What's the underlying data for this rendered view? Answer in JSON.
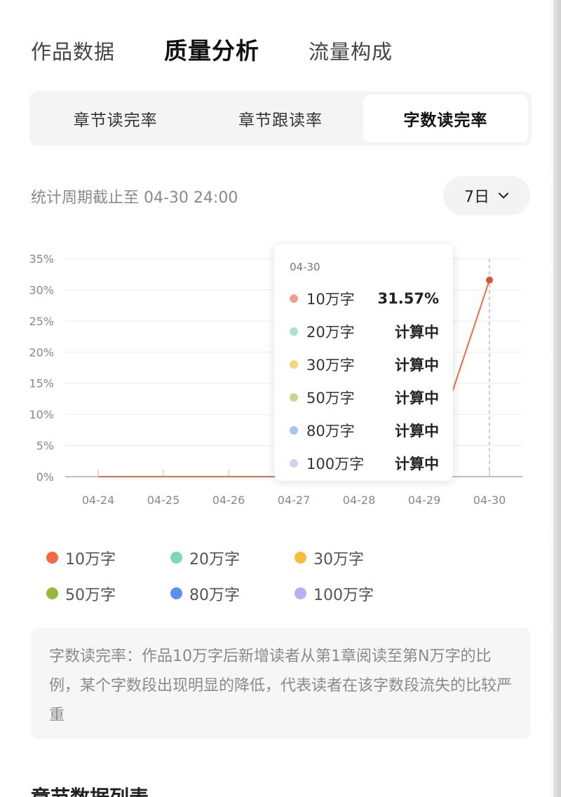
{
  "tabs": [
    {
      "label": "作品数据",
      "active": false
    },
    {
      "label": "质量分析",
      "active": true
    },
    {
      "label": "流量构成",
      "active": false
    }
  ],
  "segments": [
    {
      "label": "章节读完率",
      "active": false
    },
    {
      "label": "章节跟读率",
      "active": false
    },
    {
      "label": "字数读完率",
      "active": true
    }
  ],
  "period": {
    "text": "统计周期截止至 04-30 24:00"
  },
  "range_selector": {
    "value": "7日",
    "icon": "chevron-down-icon"
  },
  "chart_data": {
    "type": "line",
    "categories": [
      "04-24",
      "04-25",
      "04-26",
      "04-27",
      "04-28",
      "04-29",
      "04-30"
    ],
    "y_ticks": [
      "35%",
      "30%",
      "25%",
      "20%",
      "15%",
      "10%",
      "5%",
      "0%"
    ],
    "ylim": [
      0,
      35
    ],
    "grid": true,
    "series": [
      {
        "name": "10万字",
        "color": "#f26b45",
        "values": [
          0,
          0,
          0,
          0,
          0,
          0,
          31.57
        ]
      }
    ]
  },
  "tooltip": {
    "date": "04-30",
    "rows": [
      {
        "name": "10万字",
        "value": "31.57%",
        "color": "#f0a088"
      },
      {
        "name": "20万字",
        "value": "计算中",
        "color": "#a9e3cc"
      },
      {
        "name": "30万字",
        "value": "计算中",
        "color": "#f5d480"
      },
      {
        "name": "50万字",
        "value": "计算中",
        "color": "#c4d98e"
      },
      {
        "name": "80万字",
        "value": "计算中",
        "color": "#a9c3f0"
      },
      {
        "name": "100万字",
        "value": "计算中",
        "color": "#d6d0f3"
      }
    ]
  },
  "legend": [
    {
      "label": "10万字",
      "color": "#f26b45"
    },
    {
      "label": "20万字",
      "color": "#7fd8b1"
    },
    {
      "label": "30万字",
      "color": "#f5bd3a"
    },
    {
      "label": "50万字",
      "color": "#99b83a"
    },
    {
      "label": "80万字",
      "color": "#5b8ff0"
    },
    {
      "label": "100万字",
      "color": "#b8aef0"
    }
  ],
  "description": "字数读完率：作品10万字后新增读者从第1章阅读至第N万字的比例，某个字数段出现明显的降低，代表读者在该字数段流失的比较严重",
  "section_title": "章节数据列表"
}
